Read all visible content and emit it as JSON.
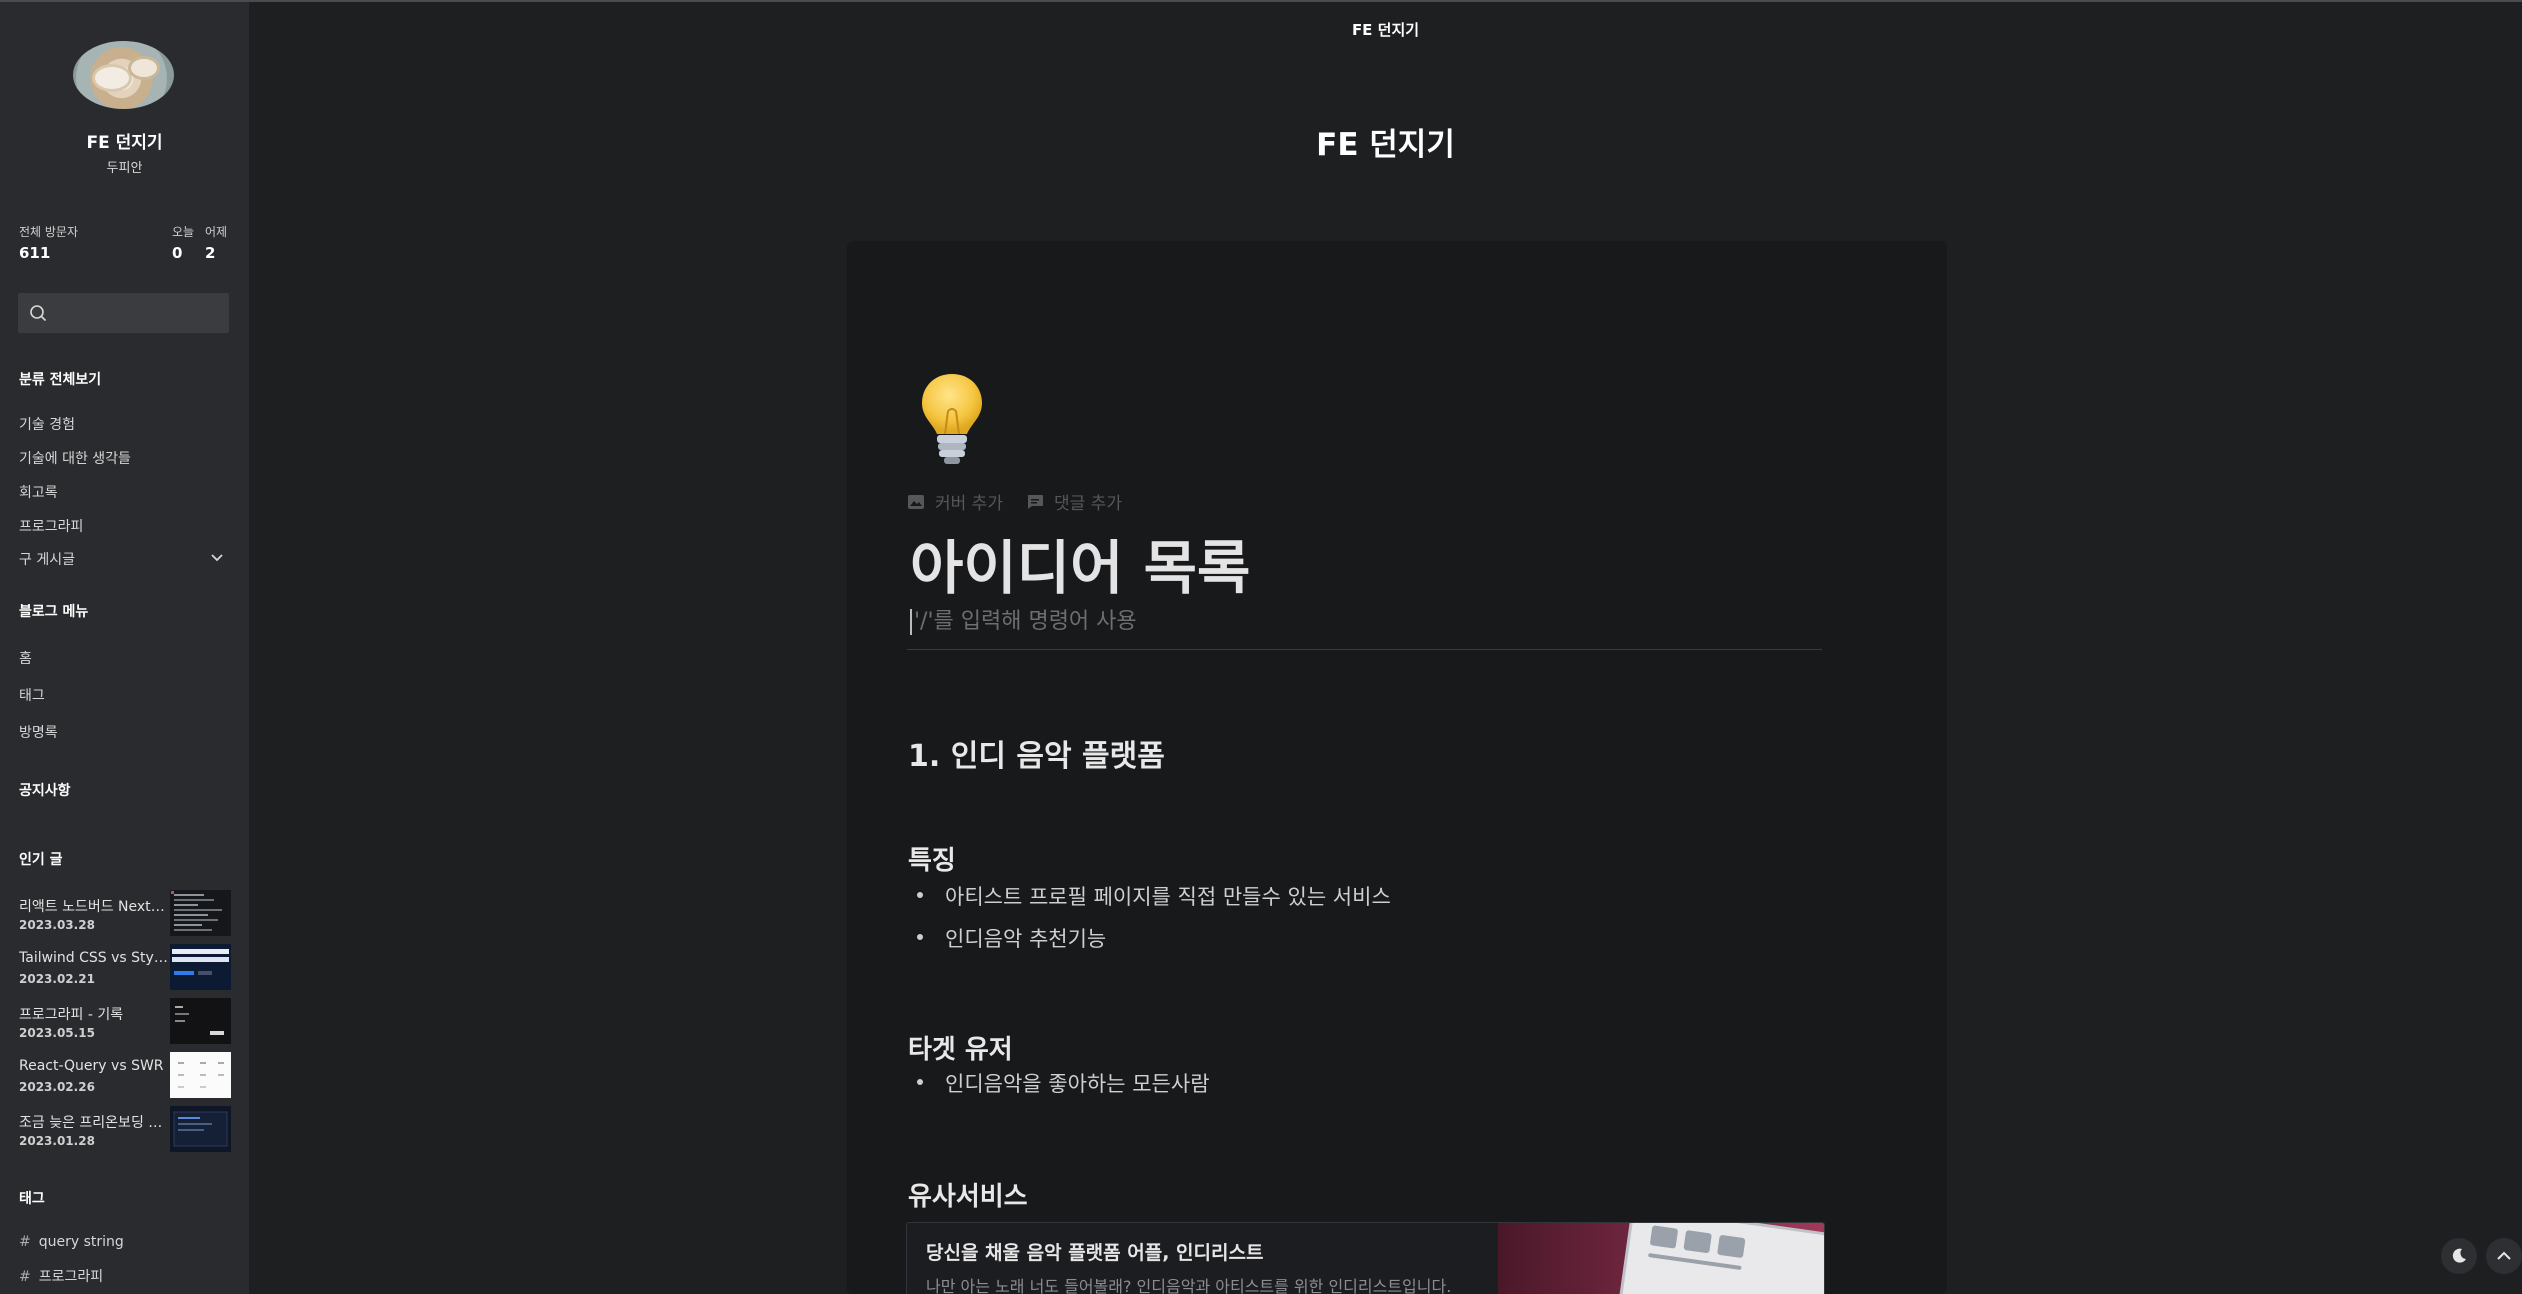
{
  "header": {
    "blog_name": "FE 던지기"
  },
  "sidebar": {
    "blog_title": "FE 던지기",
    "owner": "두피안",
    "stats": {
      "total_label": "전체 방문자",
      "total_value": "611",
      "today_label": "오늘",
      "today_value": "0",
      "yesterday_label": "어제",
      "yesterday_value": "2"
    },
    "search": {
      "placeholder": ""
    },
    "category_title": "분류 전체보기",
    "categories": [
      {
        "label": "기술 경험"
      },
      {
        "label": "기술에 대한 생각들"
      },
      {
        "label": "회고록"
      },
      {
        "label": "프로그라피"
      },
      {
        "label": "구 게시글"
      }
    ],
    "menu_title": "블로그 메뉴",
    "menu": [
      {
        "label": "홈"
      },
      {
        "label": "태그"
      },
      {
        "label": "방명록"
      }
    ],
    "notice_title": "공지사항",
    "popular_title": "인기 글",
    "popular": [
      {
        "title": "리액트 노드버드 Next.js 마이그레이션",
        "date": "2023.03.28"
      },
      {
        "title": "Tailwind CSS vs Styled Components",
        "date": "2023.02.21"
      },
      {
        "title": "프로그라피 - 기록",
        "date": "2023.05.15"
      },
      {
        "title": "React-Query vs SWR",
        "date": "2023.02.26"
      },
      {
        "title": "조금 늦은 프리온보딩 후기",
        "date": "2023.01.28"
      }
    ],
    "tags_title": "태그",
    "tags": [
      {
        "label": "query string"
      },
      {
        "label": "프로그라피"
      }
    ]
  },
  "main": {
    "page_title": "FE 던지기",
    "doc": {
      "icon": "lightbulb-icon",
      "add_cover_label": "커버 추가",
      "add_comment_label": "댓글 추가",
      "title": "아이디어 목록",
      "command_hint": "'/'를 입력해 명령어 사용",
      "section_heading": "1. 인디 음악 플랫폼",
      "features_heading": "특징",
      "features": [
        "아티스트 프로필 페이지를 직접 만들수 있는 서비스",
        "인디음악 추천기능"
      ],
      "target_heading": "타겟 유저",
      "targets": [
        "인디음악을 좋아하는 모든사람"
      ],
      "similar_heading": "유사서비스",
      "bookmark": {
        "title": "당신을 채울 음악 플랫폼 어플, 인디리스트",
        "description": "나만 아는 노래 너도 들어볼래? 인디음악과 아티스트를 위한 인디리스트입니다."
      }
    }
  },
  "controls": {
    "theme_icon": "moon-icon",
    "top_icon": "chevron-up-icon"
  },
  "colors": {
    "background": "#1e1f21",
    "sidebar": "#2a2b2e",
    "card": "#18191b"
  }
}
